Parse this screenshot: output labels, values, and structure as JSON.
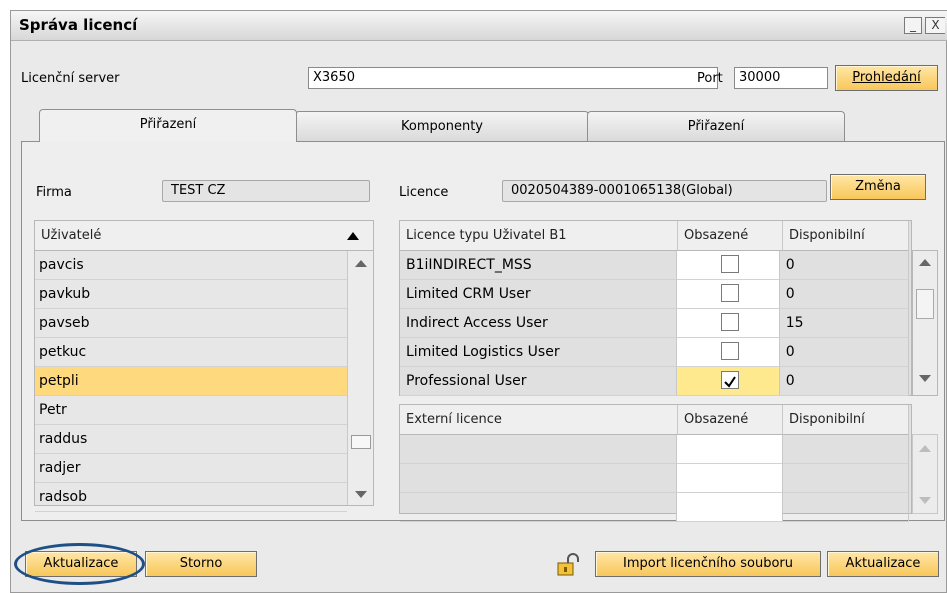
{
  "window": {
    "title": "Správa licencí",
    "minimize_glyph": "_",
    "close_glyph": "X"
  },
  "server": {
    "label": "Licenční server",
    "value": "X3650",
    "port_label": "Port",
    "port_value": "30000",
    "search_button": "Prohledání"
  },
  "tabs": [
    {
      "label": "Přiřazení",
      "active": true
    },
    {
      "label": "Komponenty",
      "active": false
    },
    {
      "label": "Přiřazení",
      "active": false
    }
  ],
  "assignment": {
    "company_label": "Firma",
    "company_value": "TEST CZ",
    "license_label": "Licence",
    "license_value": "0020504389-0001065138(Global)",
    "change_button": "Změna"
  },
  "users": {
    "header": "Uživatelé",
    "items": [
      "pavcis",
      "pavkub",
      "pavseb",
      "petkuc",
      "petpli",
      "Petr",
      "raddus",
      "radjer",
      "radsob"
    ],
    "selected": "petpli"
  },
  "b1_licenses": {
    "headers": [
      "Licence typu Uživatel B1",
      "Obsazené",
      "Disponibilní"
    ],
    "rows": [
      {
        "name": "B1iINDIRECT_MSS",
        "checked": false,
        "available": "0"
      },
      {
        "name": "Limited CRM User",
        "checked": false,
        "available": "0"
      },
      {
        "name": "Indirect Access User",
        "checked": false,
        "available": "15"
      },
      {
        "name": "Limited Logistics User",
        "checked": false,
        "available": "0"
      },
      {
        "name": "Professional User",
        "checked": true,
        "available": "0"
      }
    ]
  },
  "external_licenses": {
    "headers": [
      "Externí licence",
      "Obsazené",
      "Disponibilní"
    ],
    "rows": 3
  },
  "footer": {
    "update_left": "Aktualizace",
    "cancel": "Storno",
    "import_button": "Import licenčního souboru",
    "update_right": "Aktualizace"
  },
  "colors": {
    "button_accent": "#f8c75a",
    "selection": "#ffd97d",
    "highlight_ring": "#1e4f86"
  },
  "icons": {
    "lock": "lock-icon",
    "sort": "sort-up-icon",
    "check": "check-icon"
  }
}
